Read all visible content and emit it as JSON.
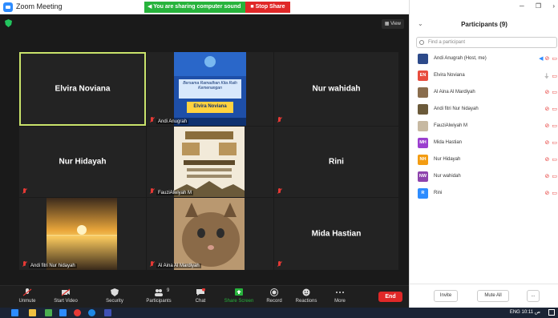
{
  "window": {
    "title": "Zoom Meeting",
    "share_message": "You are sharing computer sound",
    "stop_share_label": "Stop Share",
    "view_label": "View"
  },
  "tiles": [
    {
      "name": "Elvira Noviana",
      "label": "",
      "kind": "name",
      "active": true
    },
    {
      "name": "",
      "label": "Andi Anugrah",
      "kind": "poster-blue"
    },
    {
      "name": "Nur wahidah",
      "label": "",
      "kind": "name"
    },
    {
      "name": "Nur Hidayah",
      "label": "",
      "kind": "name"
    },
    {
      "name": "",
      "label": "FauziAlwiyah M",
      "kind": "poster-ramadan"
    },
    {
      "name": "Rini",
      "label": "",
      "kind": "name"
    },
    {
      "name": "",
      "label": "Andi fitri Nur hidayah",
      "kind": "sunset"
    },
    {
      "name": "",
      "label": "Al Aina Al Mardiyah",
      "kind": "cat"
    },
    {
      "name": "Mida Hastian",
      "label": "",
      "kind": "name"
    }
  ],
  "poster_blue": {
    "title_text": "Bersama Ramadhan Kita Raih Kemenangan",
    "name_text": "Elvira Noviana"
  },
  "toolbar": {
    "unmute": "Unmute",
    "start_video": "Start Video",
    "security": "Security",
    "participants": "Participants",
    "participants_count": "9",
    "chat": "Chat",
    "share_screen": "Share Screen",
    "record": "Record",
    "reactions": "Reactions",
    "more": "More",
    "end": "End"
  },
  "panel": {
    "title": "Participants (9)",
    "search_placeholder": "Find a participant",
    "participants": [
      {
        "name": "Andi Anugrah (Host, me)",
        "initials": "",
        "color": "#2d4a8a"
      },
      {
        "name": "Elvira Noviana",
        "initials": "EN",
        "color": "#e84c3d"
      },
      {
        "name": "Al Aina Al Mardiyah",
        "initials": "",
        "color": "#8a6d4d"
      },
      {
        "name": "Andi fitri Nur hidayah",
        "initials": "",
        "color": "#6b5a3a"
      },
      {
        "name": "FauziAlwiyah M",
        "initials": "",
        "color": "#c7b9a2"
      },
      {
        "name": "Mida Hastian",
        "initials": "MH",
        "color": "#9b3fcf"
      },
      {
        "name": "Nur Hidayah",
        "initials": "NH",
        "color": "#f39c12"
      },
      {
        "name": "Nur wahidah",
        "initials": "NW",
        "color": "#8e44ad"
      },
      {
        "name": "Rini",
        "initials": "R",
        "color": "#2d8cff"
      }
    ],
    "invite": "Invite",
    "mute_all": "Mute All",
    "more": "..."
  },
  "taskbar": {
    "tray_text": "ENG  10:11 ص"
  },
  "colors": {
    "accent_green": "#27b33c",
    "danger_red": "#e02828",
    "zoom_blue": "#2d8cff",
    "active_border": "#c9e36b"
  }
}
